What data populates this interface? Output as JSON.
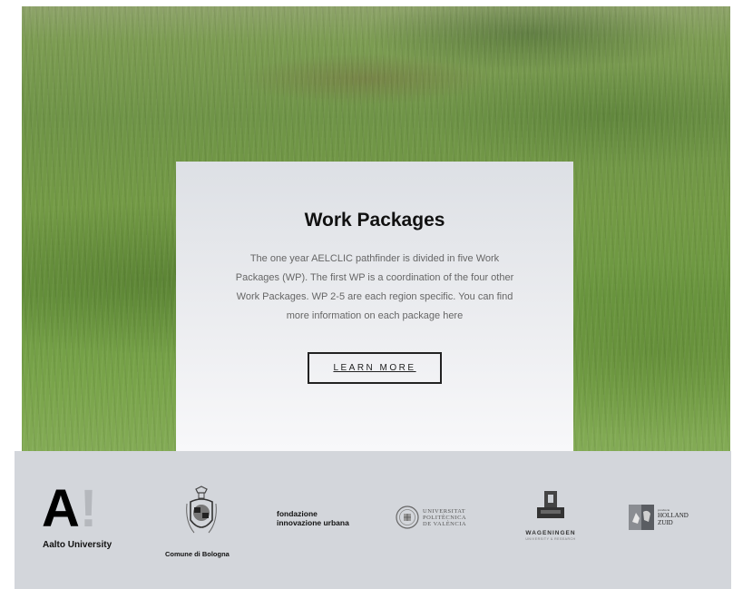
{
  "card": {
    "title": "Work Packages",
    "body": "The one year AELCLIC pathfinder is divided in five Work Packages (WP). The first WP is a coordination of the four other Work Packages. WP 2-5 are each region specific. You can find more information on each package here",
    "button_label": "LEARN MORE"
  },
  "partners": {
    "aalto": {
      "mark_a": "A",
      "mark_ex": "!",
      "name": "Aalto University"
    },
    "bologna": {
      "name": "Comune di Bologna"
    },
    "fiu": {
      "line1": "fondazione",
      "line2": "innovazione urbana"
    },
    "upv": {
      "line1": "UNIVERSITAT",
      "line2": "POLITÈCNICA",
      "line3": "DE VALÈNCIA"
    },
    "wageningen": {
      "name": "WAGENINGEN",
      "sub": "UNIVERSITY & RESEARCH"
    },
    "zuid_holland": {
      "provincie": "provincie",
      "holland": "HOLLAND",
      "zuid": "ZUID"
    }
  },
  "colors": {
    "partner_band": "#d3d6db",
    "card_top": "#dde0e5",
    "card_bottom": "#f8f8fa",
    "grass": "#739a45"
  },
  "icons": [
    "bologna-crest-icon",
    "upv-seal-icon",
    "wageningen-tower-icon",
    "zuid-holland-emblem-icon"
  ]
}
